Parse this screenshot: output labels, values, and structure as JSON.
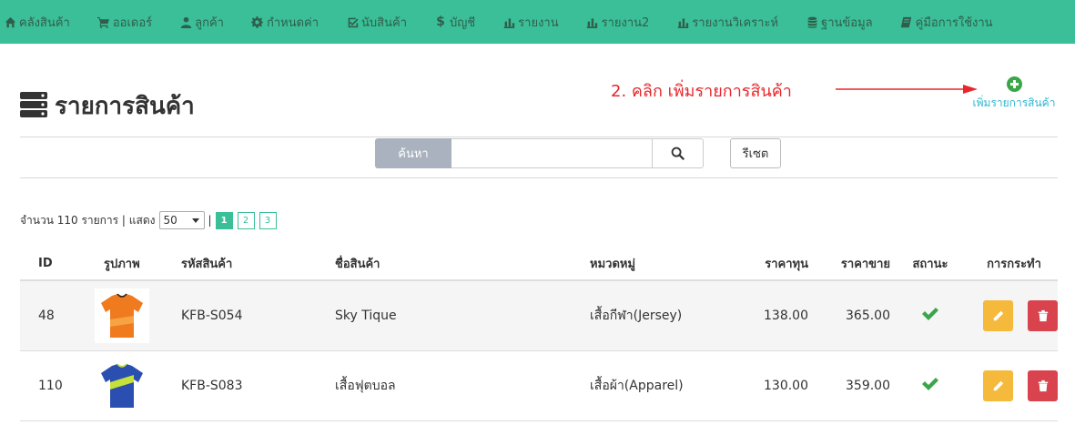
{
  "nav": [
    {
      "label": "คลังสินค้า",
      "icon": "home-icon"
    },
    {
      "label": "ออเดอร์",
      "icon": "cart-icon"
    },
    {
      "label": "ลูกค้า",
      "icon": "user-icon"
    },
    {
      "label": "กำหนดค่า",
      "icon": "gear-icon"
    },
    {
      "label": "นับสินค้า",
      "icon": "check-square-icon"
    },
    {
      "label": "บัญชี",
      "icon": "dollar-icon"
    },
    {
      "label": "รายงาน",
      "icon": "bar-chart-icon"
    },
    {
      "label": "รายงาน2",
      "icon": "bar-chart-icon"
    },
    {
      "label": "รายงานวิเคราะห์",
      "icon": "bar-chart-icon"
    },
    {
      "label": "ฐานข้อมูล",
      "icon": "database-icon"
    },
    {
      "label": "คู่มือการใช้งาน",
      "icon": "book-icon"
    }
  ],
  "page": {
    "title": "รายการสินค้า",
    "annotation": "2. คลิก เพิ่มรายการสินค้า",
    "add_product_label": "เพิ่มรายการสินค้า"
  },
  "search": {
    "label": "ค้นหา",
    "value": "",
    "reset_label": "รีเซต"
  },
  "pager": {
    "summary": "จำนวน 110 รายการ | แสดง",
    "per_page": "50",
    "separator": "|",
    "pages": [
      "1",
      "2",
      "3"
    ],
    "current_page": "1"
  },
  "table": {
    "headers": {
      "id": "ID",
      "image": "รูปภาพ",
      "code": "รหัสสินค้า",
      "name": "ชื่อสินค้า",
      "category": "หมวดหมู่",
      "cost": "ราคาทุน",
      "price": "ราคาขาย",
      "status": "สถานะ",
      "actions": "การกระทำ"
    },
    "rows": [
      {
        "id": "48",
        "code": "KFB-S054",
        "name": "Sky Tique",
        "category": "เสื้อกีฬา(Jersey)",
        "cost": "138.00",
        "price": "365.00",
        "image_color": "#f07a1e"
      },
      {
        "id": "110",
        "code": "KFB-S083",
        "name": "เสื้อฟุตบอล",
        "category": "เสื้อผ้า(Apparel)",
        "cost": "130.00",
        "price": "359.00",
        "image_color": "#2a4fb0"
      }
    ]
  },
  "colors": {
    "nav_bg": "#3bbf98",
    "annotation": "#e8262b",
    "link": "#2eb6d0",
    "edit": "#f5b93b",
    "delete": "#d9434e",
    "status_ok": "#3aa64a"
  }
}
